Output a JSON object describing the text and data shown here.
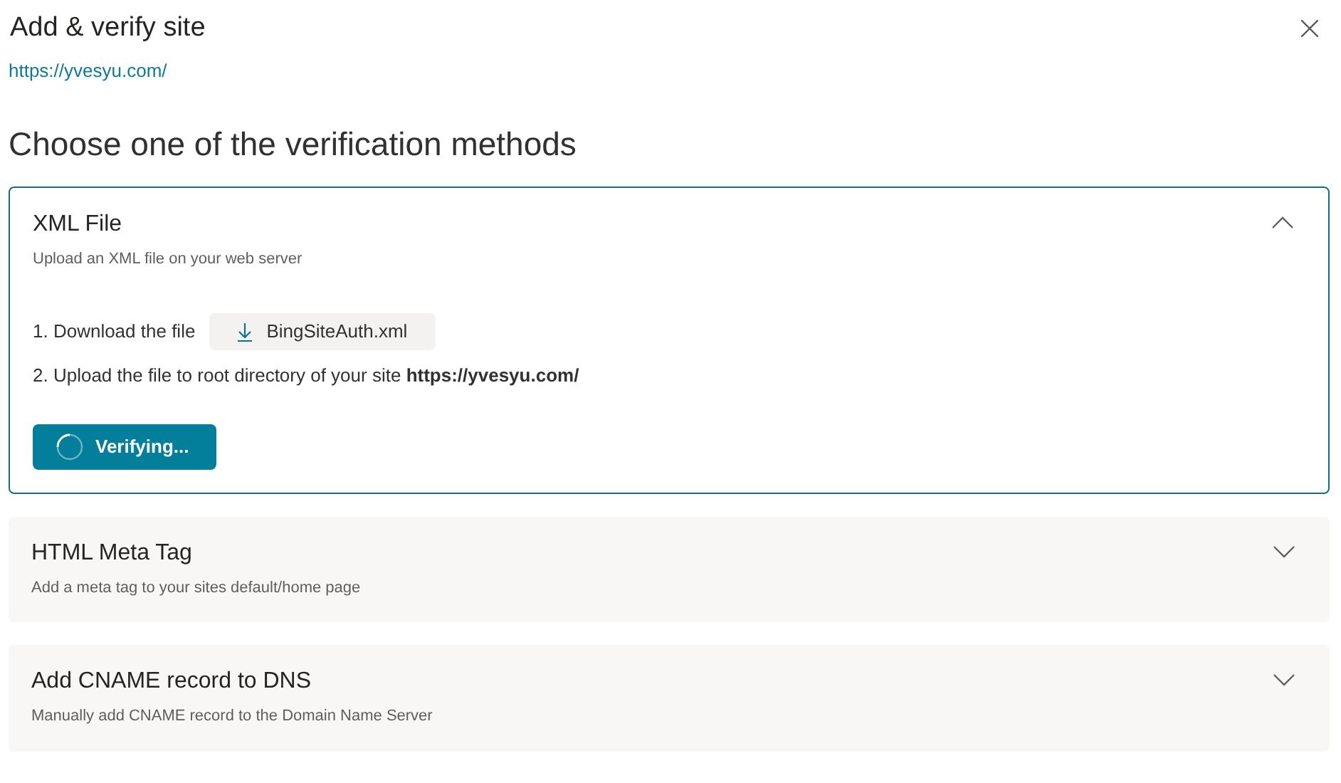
{
  "title": "Add & verify site",
  "site_url": "https://yvesyu.com/",
  "heading": "Choose one of the verification methods",
  "methods": [
    {
      "title": "XML File",
      "subtitle": "Upload an XML file on your web server",
      "expanded": true,
      "step_1": "1. Download the file",
      "download_button": "BingSiteAuth.xml",
      "step_2": "2. Upload the file to root directory of your site **https://yvesyu.com/**",
      "verify_button": "Verifying..."
    },
    {
      "title": "HTML Meta Tag",
      "subtitle": "Add a meta tag to your sites default/home page",
      "expanded": false
    },
    {
      "title": "Add CNAME record to DNS",
      "subtitle": "Manually add CNAME record to the Domain Name Server",
      "expanded": false
    }
  ]
}
